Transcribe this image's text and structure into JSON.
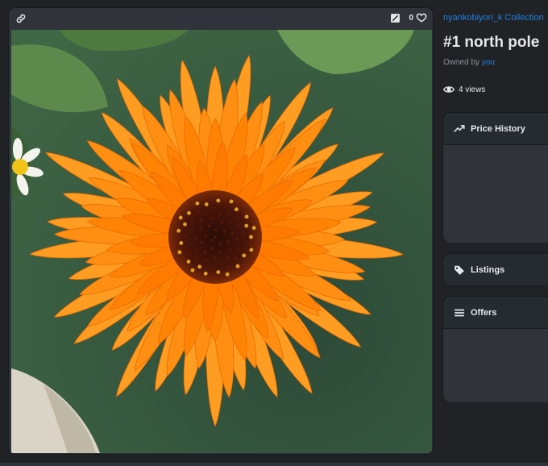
{
  "media": {
    "favorites_count": "0",
    "image_alt": "Orange calendula flower"
  },
  "item": {
    "collection": "nyankobiyori_k Collection",
    "title": "#1 north pole",
    "owned_prefix": "Owned by",
    "owner": "you",
    "views": "4 views"
  },
  "panels": {
    "price_history": "Price History",
    "listings": "Listings",
    "offers": "Offers"
  },
  "colors": {
    "accent": "#2081e2",
    "background": "#202225",
    "card": "#303339"
  },
  "icons": [
    "link-icon",
    "edit-icon",
    "heart-icon",
    "eye-icon",
    "trending-icon",
    "tag-icon",
    "list-icon"
  ]
}
